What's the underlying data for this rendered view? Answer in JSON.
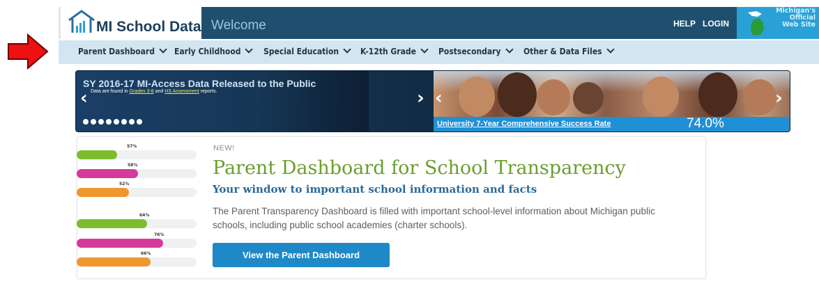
{
  "header": {
    "logo_text": "MI School Data",
    "welcome": "Welcome",
    "help": "HELP",
    "login": "LOGIN",
    "state_logo_lines": [
      "Michigan's",
      "Official",
      "Web Site"
    ]
  },
  "nav": {
    "items": [
      {
        "label": "Parent Dashboard"
      },
      {
        "label": "Early Childhood"
      },
      {
        "label": "Special Education"
      },
      {
        "label": "K-12th Grade"
      },
      {
        "label": "Postsecondary"
      },
      {
        "label": "Other & Data Files"
      }
    ]
  },
  "banner": {
    "slide1": {
      "title": "SY 2016-17 MI-Access Data Released to the Public",
      "sub_prefix": "Data are found in",
      "link1": "Grades 3-8",
      "sub_mid": "and",
      "link2": "HS Assessment",
      "sub_suffix": "reports.",
      "dot_count": 8
    },
    "slide2": {
      "link": "University 7-Year Comprehensive Success Rate",
      "value": "74.0%"
    },
    "prev_icon": "chevron-left-icon",
    "next_icon": "chevron-right-icon"
  },
  "card": {
    "tag": "NEW!",
    "title": "Parent Dashboard for School Transparency",
    "subtitle": "Your window to important school information and facts",
    "body": "The Parent Transparency Dashboard is filled with important school-level information about Michigan public schools, including public school academies (charter schools).",
    "button": "View the Parent Dashboard",
    "bars": [
      {
        "label": "57%",
        "value": 57,
        "color": "#7cbd2e"
      },
      {
        "label": "58%",
        "value": 58,
        "color": "#d63a9b"
      },
      {
        "label": "52%",
        "value": 52,
        "color": "#f0962e"
      },
      {
        "label": "64%",
        "value": 64,
        "color": "#7cbd2e"
      },
      {
        "label": "76%",
        "value": 76,
        "color": "#d63a9b"
      },
      {
        "label": "66%",
        "value": 66,
        "color": "#f0962e"
      }
    ]
  },
  "colors": {
    "header_bg": "#1e4f6e",
    "nav_bg": "#d3e5f1",
    "button_bg": "#1f89c8",
    "title_green": "#6b9e2e",
    "subtitle_blue": "#2a6a9a",
    "annotation_red": "#ee1111"
  }
}
